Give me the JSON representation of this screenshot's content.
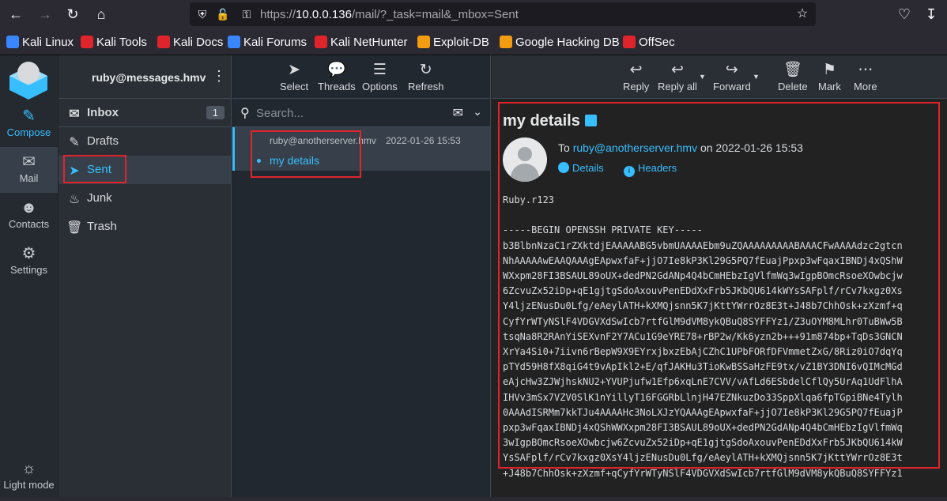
{
  "browser": {
    "url_prefix": "https://",
    "url_host": "10.0.0.136",
    "url_path": "/mail/?_task=mail&_mbox=Sent",
    "bookmarks": [
      {
        "label": "Kali Linux",
        "color": "#3a86ff"
      },
      {
        "label": "Kali Tools",
        "color": "#e0242b"
      },
      {
        "label": "Kali Docs",
        "color": "#e0242b"
      },
      {
        "label": "Kali Forums",
        "color": "#3a86ff"
      },
      {
        "label": "Kali NetHunter",
        "color": "#e0242b"
      },
      {
        "label": "Exploit-DB",
        "color": "#f39c12"
      },
      {
        "label": "Google Hacking DB",
        "color": "#f39c12"
      },
      {
        "label": "OffSec",
        "color": "#e0242b"
      }
    ]
  },
  "rail": {
    "compose": "Compose",
    "mail": "Mail",
    "contacts": "Contacts",
    "settings": "Settings",
    "light_mode": "Light mode"
  },
  "folders": {
    "account": "ruby@messages.hmv",
    "items": [
      {
        "label": "Inbox",
        "icon": "inbox-icon",
        "badge": "1"
      },
      {
        "label": "Drafts",
        "icon": "pencil-icon"
      },
      {
        "label": "Sent",
        "icon": "paper-plane-icon"
      },
      {
        "label": "Junk",
        "icon": "fire-icon"
      },
      {
        "label": "Trash",
        "icon": "trash-icon"
      }
    ]
  },
  "list": {
    "toolbar": {
      "select": "Select",
      "threads": "Threads",
      "options": "Options",
      "refresh": "Refresh"
    },
    "search_placeholder": "Search...",
    "messages": [
      {
        "from": "ruby@anotherserver.hmv",
        "date": "2022-01-26 15:53",
        "subject": "my details"
      }
    ]
  },
  "viewer": {
    "toolbar": {
      "reply": "Reply",
      "reply_all": "Reply all",
      "forward": "Forward",
      "delete": "Delete",
      "mark": "Mark",
      "more": "More"
    },
    "subject": "my details",
    "to_label": "To",
    "to_address": "ruby@anotherserver.hmv",
    "on_text": "on 2022-01-26 15:53",
    "details": "Details",
    "headers": "Headers",
    "body": "Ruby.r123\n\n-----BEGIN OPENSSH PRIVATE KEY-----\nb3BlbnNzaC1rZXktdjEAAAAABG5vbmUAAAAEbm9uZQAAAAAAAAABAAACFwAAAAdzc2gtcn\nNhAAAAAwEAAQAAAgEApwxfaF+jjO7Ie8kP3Kl29G5PQ7fEuajPpxp3wFqaxIBNDj4xQShW\nWXxpm28FI3BSAUL89oUX+dedPN2GdANp4Q4bCmHEbzIgVlfmWq3wIgpBOmcRsoeXOwbcjw\n6ZcvuZx52iDp+qE1gjtgSdoAxouvPenEDdXxFrb5JKbQU614kWYsSAFplf/rCv7kxgz0Xs\nY4ljzENusDu0Lfg/eAeylATH+kXMQjsnn5K7jKttYWrrOz8E3t+J48b7ChhOsk+zXzmf+q\nCyfYrWTyNSlF4VDGVXdSwIcb7rtfGlM9dVM8ykQBuQ8SYFFYz1/Z3uOYM8MLhr0TuBWw5B\ntsqNa8R2RAnYiSEXvnF2Y7ACu1G9eYRE78+rBP2w/Kk6yzn2b+++91m874bp+TqDs3GNCN\nXrYa4Si0+7iivn6rBepW9X9EYrxjbxzEbAjCZhC1UPbFORfDFVmmetZxG/8Riz0iO7dqYq\npTYd59H8fX8qiG4t9vApIkl2+E/qfJAKHu3TioKwBSSaHzFE9tx/vZ1BY3DNI6vQIMcMGd\neAjcHw3ZJWjhskNU2+YVUPjufw1Efp6xqLnE7CVV/vAfLd6ESbdelCflQy5UrAq1UdFlhA\nIHVv3mSx7VZV0SlK1nYillyT16FGGRbLlnjH47EZNkuzDo33SppXlqa6fpTGpiBNe4Tylh\n0AAAdISRMm7kkTJu4AAAAHc3NoLXJzYQAAAgEApwxfaF+jjO7Ie8kP3Kl29G5PQ7fEuajP\npxp3wFqaxIBNDj4xQShWWXxpm28FI3BSAUL89oUX+dedPN2GdANp4Q4bCmHEbzIgVlfmWq\n3wIgpBOmcRsoeXOwbcjw6ZcvuZx52iDp+qE1gjtgSdoAxouvPenEDdXxFrb5JKbQU614kW\nYsSAFplf/rCv7kxgz0XsY4ljzENusDu0Lfg/eAeylATH+kXMQjsnn5K7jKttYWrrOz8E3t\n+J48b7ChhOsk+zXzmf+qCyfYrWTyNSlF4VDGVXdSwIcb7rtfGlM9dVM8ykQBuQ8SYFFYz1"
  }
}
